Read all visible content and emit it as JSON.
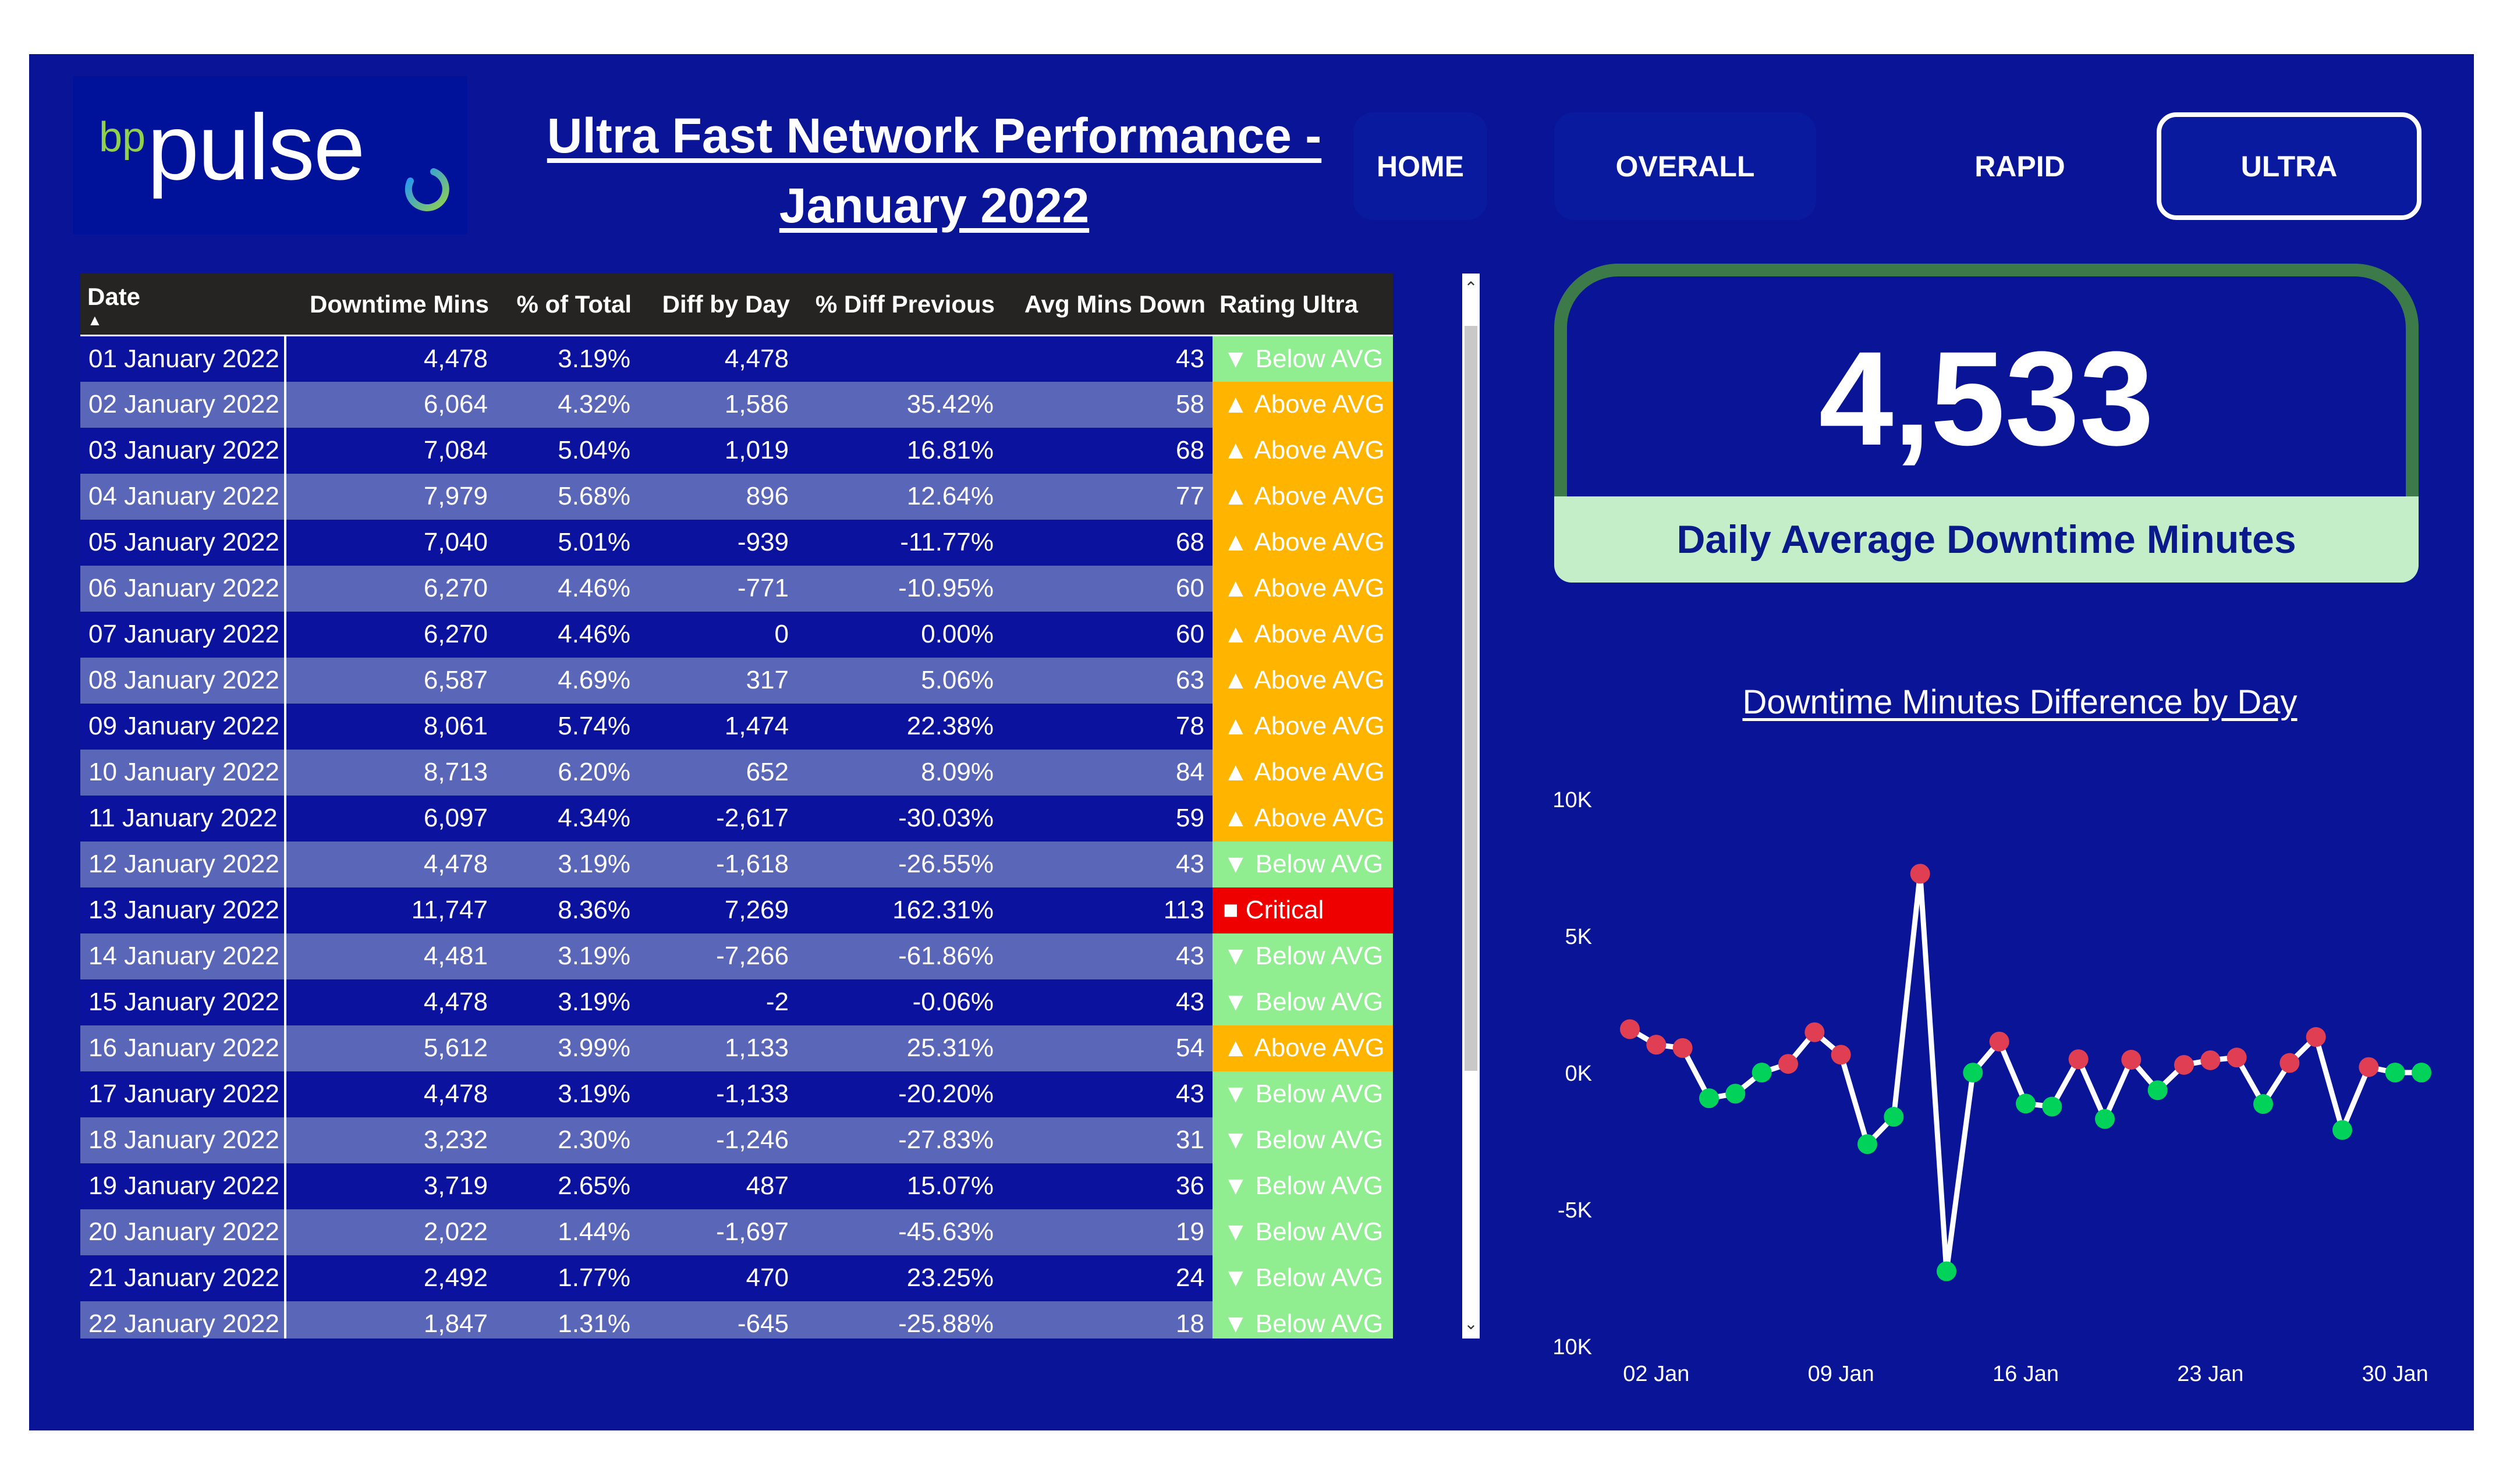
{
  "logo": {
    "bp": "bp",
    "brand": "pulse"
  },
  "title": "Ultra Fast Network Performance - January 2022",
  "nav": [
    {
      "label": "HOME"
    },
    {
      "label": "OVERALL"
    },
    {
      "label": "RAPID"
    },
    {
      "label": "ULTRA",
      "selected": true
    }
  ],
  "table": {
    "columns": [
      "Date",
      "Downtime Mins",
      "% of Total",
      "Diff by Day",
      "% Diff Previous",
      "Avg Mins Down",
      "Rating Ultra"
    ],
    "sort_indicator": "▲",
    "rows": [
      [
        "01 January 2022",
        "4,478",
        "3.19%",
        "4,478",
        "",
        "43",
        "▼ Below AVG"
      ],
      [
        "02 January 2022",
        "6,064",
        "4.32%",
        "1,586",
        "35.42%",
        "58",
        "▲ Above AVG"
      ],
      [
        "03 January 2022",
        "7,084",
        "5.04%",
        "1,019",
        "16.81%",
        "68",
        "▲ Above AVG"
      ],
      [
        "04 January 2022",
        "7,979",
        "5.68%",
        "896",
        "12.64%",
        "77",
        "▲ Above AVG"
      ],
      [
        "05 January 2022",
        "7,040",
        "5.01%",
        "-939",
        "-11.77%",
        "68",
        "▲ Above AVG"
      ],
      [
        "06 January 2022",
        "6,270",
        "4.46%",
        "-771",
        "-10.95%",
        "60",
        "▲ Above AVG"
      ],
      [
        "07 January 2022",
        "6,270",
        "4.46%",
        "0",
        "0.00%",
        "60",
        "▲ Above AVG"
      ],
      [
        "08 January 2022",
        "6,587",
        "4.69%",
        "317",
        "5.06%",
        "63",
        "▲ Above AVG"
      ],
      [
        "09 January 2022",
        "8,061",
        "5.74%",
        "1,474",
        "22.38%",
        "78",
        "▲ Above AVG"
      ],
      [
        "10 January 2022",
        "8,713",
        "6.20%",
        "652",
        "8.09%",
        "84",
        "▲ Above AVG"
      ],
      [
        "11 January 2022",
        "6,097",
        "4.34%",
        "-2,617",
        "-30.03%",
        "59",
        "▲ Above AVG"
      ],
      [
        "12 January 2022",
        "4,478",
        "3.19%",
        "-1,618",
        "-26.55%",
        "43",
        "▼ Below AVG"
      ],
      [
        "13 January 2022",
        "11,747",
        "8.36%",
        "7,269",
        "162.31%",
        "113",
        "■ Critical"
      ],
      [
        "14 January 2022",
        "4,481",
        "3.19%",
        "-7,266",
        "-61.86%",
        "43",
        "▼ Below AVG"
      ],
      [
        "15 January 2022",
        "4,478",
        "3.19%",
        "-2",
        "-0.06%",
        "43",
        "▼ Below AVG"
      ],
      [
        "16 January 2022",
        "5,612",
        "3.99%",
        "1,133",
        "25.31%",
        "54",
        "▲ Above AVG"
      ],
      [
        "17 January 2022",
        "4,478",
        "3.19%",
        "-1,133",
        "-20.20%",
        "43",
        "▼ Below AVG"
      ],
      [
        "18 January 2022",
        "3,232",
        "2.30%",
        "-1,246",
        "-27.83%",
        "31",
        "▼ Below AVG"
      ],
      [
        "19 January 2022",
        "3,719",
        "2.65%",
        "487",
        "15.07%",
        "36",
        "▼ Below AVG"
      ],
      [
        "20 January 2022",
        "2,022",
        "1.44%",
        "-1,697",
        "-45.63%",
        "19",
        "▼ Below AVG"
      ],
      [
        "21 January 2022",
        "2,492",
        "1.77%",
        "470",
        "23.25%",
        "24",
        "▼ Below AVG"
      ],
      [
        "22 January 2022",
        "1,847",
        "1.31%",
        "-645",
        "-25.88%",
        "18",
        "▼ Below AVG"
      ]
    ],
    "rating_colors": {
      "below": "#90ee90",
      "above": "#ffb400",
      "critical": "#ee0000"
    }
  },
  "scrollbar": {
    "up": "⌃",
    "down": "⌄"
  },
  "kpi": {
    "value": "4,533",
    "label": "Daily Average Downtime Minutes"
  },
  "chart_data": {
    "type": "line",
    "title": "Downtime Minutes Difference by Day",
    "yticks": [
      "10K",
      "5K",
      "0K",
      "-5K",
      "-10K"
    ],
    "xticks": [
      "02 Jan",
      "09 Jan",
      "16 Jan",
      "23 Jan",
      "30 Jan"
    ],
    "ylim": [
      -10000,
      10000
    ],
    "x": [
      "01 Jan",
      "02 Jan",
      "03 Jan",
      "04 Jan",
      "05 Jan",
      "06 Jan",
      "07 Jan",
      "08 Jan",
      "09 Jan",
      "10 Jan",
      "11 Jan",
      "12 Jan",
      "13 Jan",
      "14 Jan",
      "15 Jan",
      "16 Jan",
      "17 Jan",
      "18 Jan",
      "19 Jan",
      "20 Jan",
      "21 Jan",
      "22 Jan",
      "23 Jan",
      "24 Jan",
      "25 Jan",
      "26 Jan",
      "27 Jan",
      "28 Jan",
      "29 Jan",
      "30 Jan",
      "31 Jan"
    ],
    "values": [
      1586,
      1019,
      896,
      -939,
      -771,
      0,
      317,
      1474,
      652,
      -2617,
      -1618,
      7269,
      -7266,
      -2,
      1133,
      -1133,
      -1246,
      487,
      -1697,
      470,
      -645,
      280,
      450,
      550,
      -1150,
      350,
      1300,
      -2100,
      200,
      0,
      0
    ],
    "colors": {
      "positive": "#e03e52",
      "negative": "#00d25a",
      "line": "#ffffff"
    },
    "grid": false
  }
}
